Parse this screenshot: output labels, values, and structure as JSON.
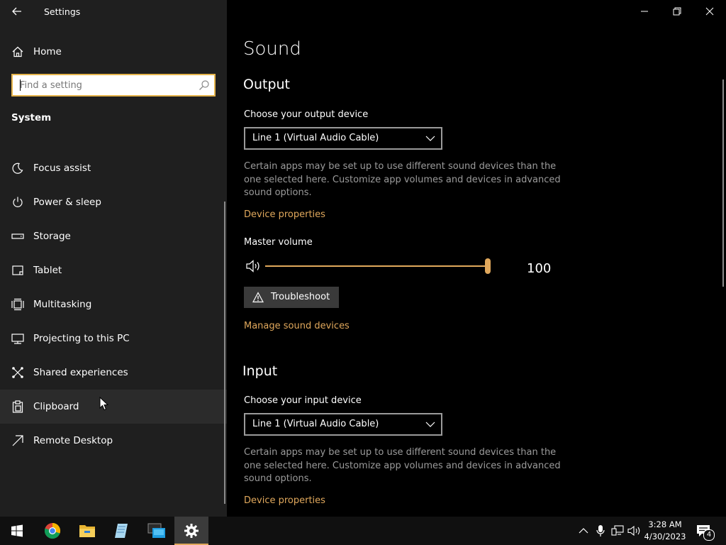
{
  "window": {
    "title": "Settings"
  },
  "sidebar": {
    "home_label": "Home",
    "search_placeholder": "Find a setting",
    "section_title": "System",
    "items": [
      {
        "label": "Focus assist",
        "icon": "moon-icon"
      },
      {
        "label": "Power & sleep",
        "icon": "power-icon"
      },
      {
        "label": "Storage",
        "icon": "storage-icon"
      },
      {
        "label": "Tablet",
        "icon": "tablet-icon"
      },
      {
        "label": "Multitasking",
        "icon": "multitasking-icon"
      },
      {
        "label": "Projecting to this PC",
        "icon": "projecting-icon"
      },
      {
        "label": "Shared experiences",
        "icon": "shared-experiences-icon"
      },
      {
        "label": "Clipboard",
        "icon": "clipboard-icon"
      },
      {
        "label": "Remote Desktop",
        "icon": "remote-desktop-icon"
      }
    ]
  },
  "main": {
    "page_title": "Sound",
    "output": {
      "heading": "Output",
      "device_label": "Choose your output device",
      "device_value": "Line 1 (Virtual Audio Cable)",
      "note": "Certain apps may be set up to use different sound devices than the one selected here. Customize app volumes and devices in advanced sound options.",
      "device_properties_link": "Device properties",
      "master_volume_label": "Master volume",
      "volume_value": "100",
      "volume_level": 100,
      "troubleshoot_label": "Troubleshoot",
      "manage_link": "Manage sound devices"
    },
    "input": {
      "heading": "Input",
      "device_label": "Choose your input device",
      "device_value": "Line 1 (Virtual Audio Cable)",
      "note": "Certain apps may be set up to use different sound devices than the one selected here. Customize app volumes and devices in advanced sound options.",
      "device_properties_link": "Device properties"
    }
  },
  "taskbar": {
    "time": "3:28 AM",
    "date": "4/30/2023",
    "notification_count": "4",
    "apps": [
      "start-icon",
      "chrome-icon",
      "file-explorer-icon",
      "notepad-icon",
      "remote-desktop-app-icon",
      "settings-gear-icon"
    ]
  },
  "colors": {
    "accent": "#e0a85c",
    "sidebar_bg": "#1f1f1f",
    "main_bg": "#000000",
    "search_border": "#e5b44c"
  }
}
